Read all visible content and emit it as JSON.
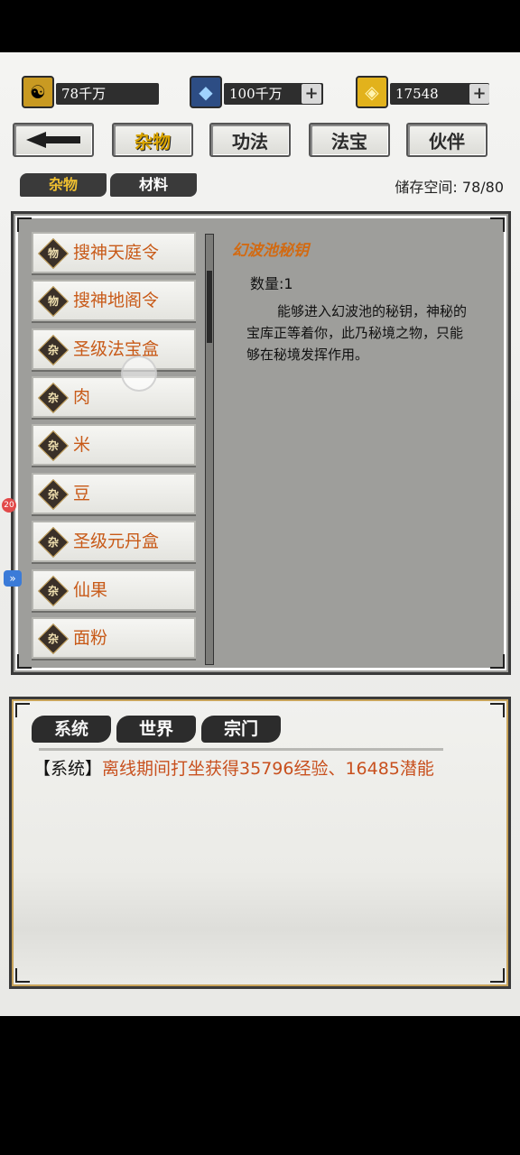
{
  "currencies": [
    {
      "icon": "yin-yang-icon",
      "value": "78千万"
    },
    {
      "icon": "blue-gem-icon",
      "value": "100千万",
      "plus": "+"
    },
    {
      "icon": "gold-ingot-icon",
      "value": "17548",
      "plus": "+"
    }
  ],
  "nav": {
    "back_icon": "back-arrow-icon",
    "tabs": [
      "杂物",
      "功法",
      "法宝",
      "伙伴"
    ],
    "active": "杂物"
  },
  "subtabs": [
    "杂物",
    "材料"
  ],
  "storage": "储存空间: 78/80",
  "items": [
    {
      "badge": "物",
      "label": "搜神天庭令"
    },
    {
      "badge": "物",
      "label": "搜神地阁令"
    },
    {
      "badge": "杂",
      "label": "圣级法宝盒"
    },
    {
      "badge": "杂",
      "label": "肉"
    },
    {
      "badge": "杂",
      "label": "米"
    },
    {
      "badge": "杂",
      "label": "豆"
    },
    {
      "badge": "杂",
      "label": "圣级元丹盒"
    },
    {
      "badge": "杂",
      "label": "仙果"
    },
    {
      "badge": "杂",
      "label": "面粉"
    }
  ],
  "detail": {
    "title": "幻波池秘钥",
    "quantity": "数量:1",
    "description": "能够进入幻波池的秘钥，神秘的宝库正等着你，此乃秘境之物，只能够在秘境发挥作用。"
  },
  "float_badge": "20",
  "float_arrow": "»",
  "chat": {
    "tabs": [
      "系统",
      "世界",
      "宗门"
    ],
    "lines": [
      {
        "tag": "【系统】",
        "text": "离线期间打坐获得35796经验、16485潜能"
      }
    ]
  }
}
